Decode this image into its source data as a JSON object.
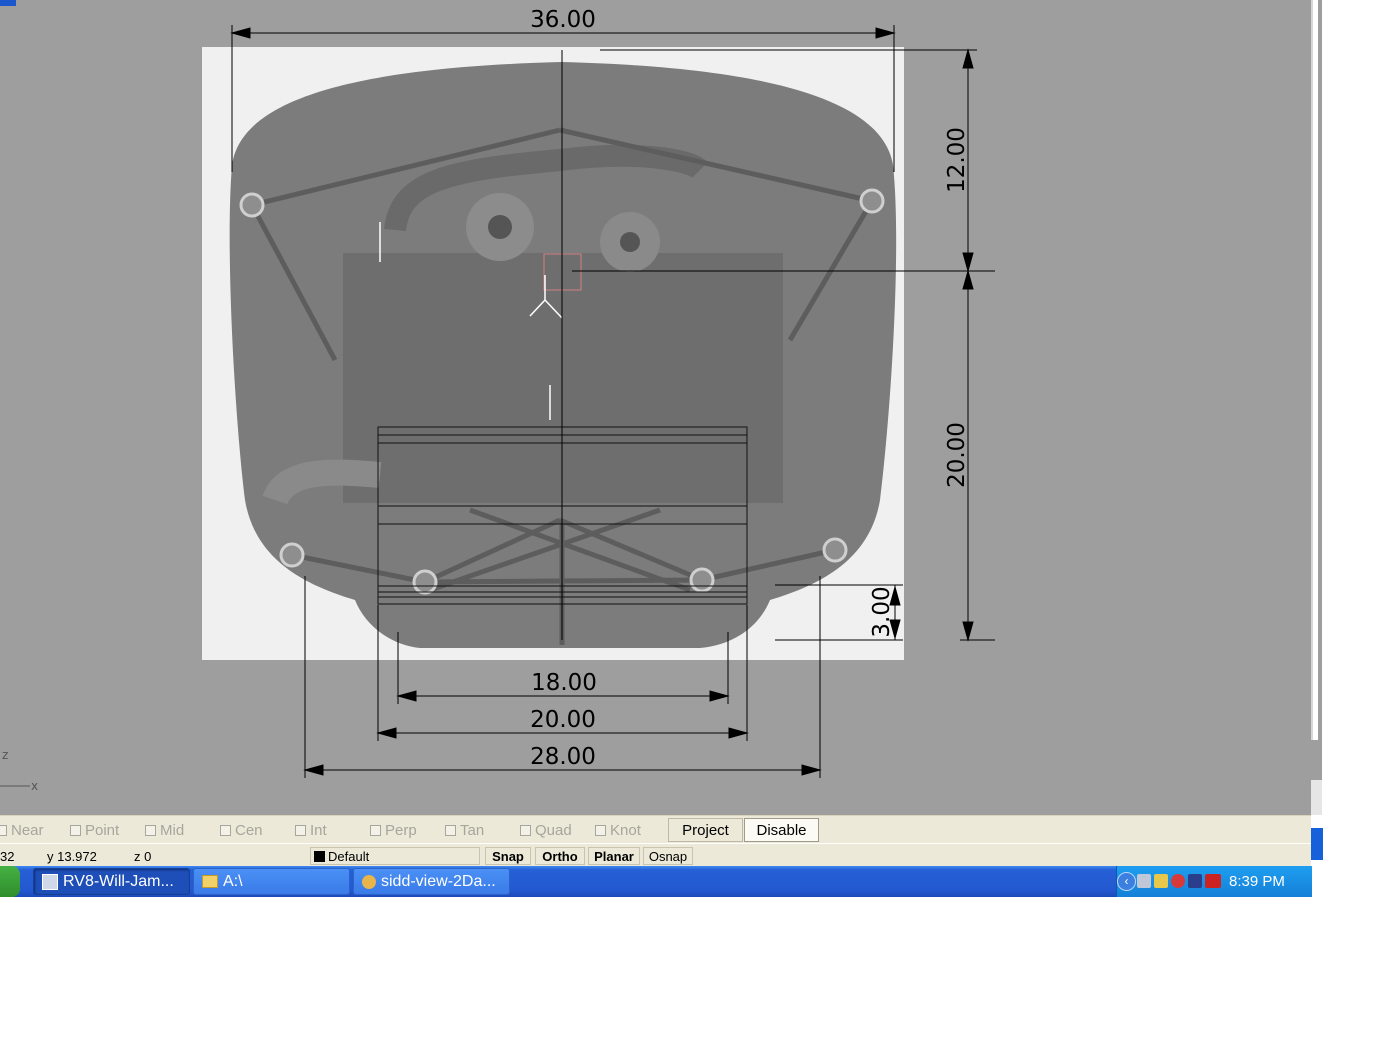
{
  "drawing": {
    "dimensions": {
      "top_width": "36.00",
      "upper_height": "12.00",
      "lower_height": "20.00",
      "small_height": "3.00",
      "inner_width": "18.00",
      "middle_width": "20.00",
      "outer_width": "28.00"
    },
    "axis_labels": {
      "z": "z",
      "x": "x"
    }
  },
  "osnap": {
    "items": [
      {
        "label": "Near",
        "checked": false
      },
      {
        "label": "Point",
        "checked": false
      },
      {
        "label": "Mid",
        "checked": false
      },
      {
        "label": "Cen",
        "checked": false
      },
      {
        "label": "Int",
        "checked": false
      },
      {
        "label": "Perp",
        "checked": false
      },
      {
        "label": "Tan",
        "checked": false
      },
      {
        "label": "Quad",
        "checked": false
      },
      {
        "label": "Knot",
        "checked": false
      }
    ],
    "project_label": "Project",
    "disable_label": "Disable"
  },
  "status": {
    "x_partial": "32",
    "y": "y 13.972",
    "z": "z 0",
    "layer": "Default",
    "snap": "Snap",
    "ortho": "Ortho",
    "planar": "Planar",
    "osnap": "Osnap"
  },
  "taskbar": {
    "buttons": [
      {
        "label": "RV8-Will-Jam..."
      },
      {
        "label": "A:\\"
      },
      {
        "label": "sidd-view-2Da..."
      }
    ],
    "clock": "8:39 PM"
  }
}
